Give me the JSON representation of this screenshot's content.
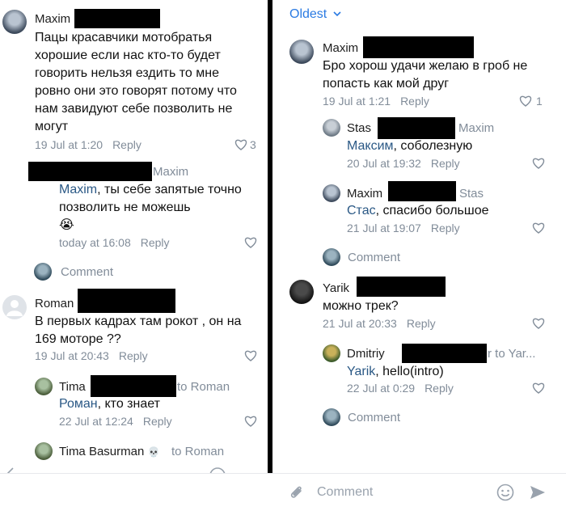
{
  "left": {
    "c1": {
      "name": "Maxim",
      "text": "Пацы красавчики мотобратья хорошие если нас кто-то будет говорить нельзя ездить то мне ровно они это говорят потому что нам завидуют себе позволить не могут",
      "date": "19 Jul at 1:20",
      "reply": "Reply",
      "likes": "3"
    },
    "r1": {
      "to": "Maxim",
      "mention": "Maxim",
      "text": ", ты себе запятые точно позволить не можешь",
      "emoji": "😭",
      "date": "today at 16:08",
      "reply": "Reply"
    },
    "comment_link": "Comment",
    "c2": {
      "name": "Roman",
      "text": "В первых кадрах там рокот , он на 169 моторе ??",
      "date": "19 Jul at 20:43",
      "reply": "Reply"
    },
    "r2": {
      "name": "Tima",
      "to": "to Roman",
      "mention": "Роман",
      "text": ", кто знает",
      "date": "22 Jul at 12:24",
      "reply": "Reply"
    },
    "r3": {
      "name": "Tima Basurman",
      "emoji": "💀",
      "to": "to Roman"
    }
  },
  "right": {
    "sort_label": "Oldest",
    "c1": {
      "name": "Maxim",
      "text": "Бро хорош удачи желаю в гроб не попасть как мой друг",
      "date": "19 Jul at 1:21",
      "reply": "Reply",
      "likes": "1"
    },
    "r1": {
      "name": "Stas",
      "to": "Maxim",
      "mention": "Максим",
      "text": ", соболезную",
      "date": "20 Jul at 19:32",
      "reply": "Reply"
    },
    "r2": {
      "name": "Maxim",
      "to": "Stas",
      "mention": "Стас",
      "text": ", спасибо большое",
      "date": "21 Jul at 19:07",
      "reply": "Reply"
    },
    "comment_link1": "Comment",
    "c2": {
      "name": "Yarik",
      "text": "можно трек?",
      "date": "21 Jul at 20:33",
      "reply": "Reply"
    },
    "r3": {
      "name": "Dmitriy",
      "to": "r  to Yar...",
      "mention": "Yarik",
      "text": ", hello(intro)",
      "date": "22 Jul at 0:29",
      "reply": "Reply"
    },
    "comment_link2": "Comment"
  },
  "input": {
    "placeholder": "Comment"
  }
}
